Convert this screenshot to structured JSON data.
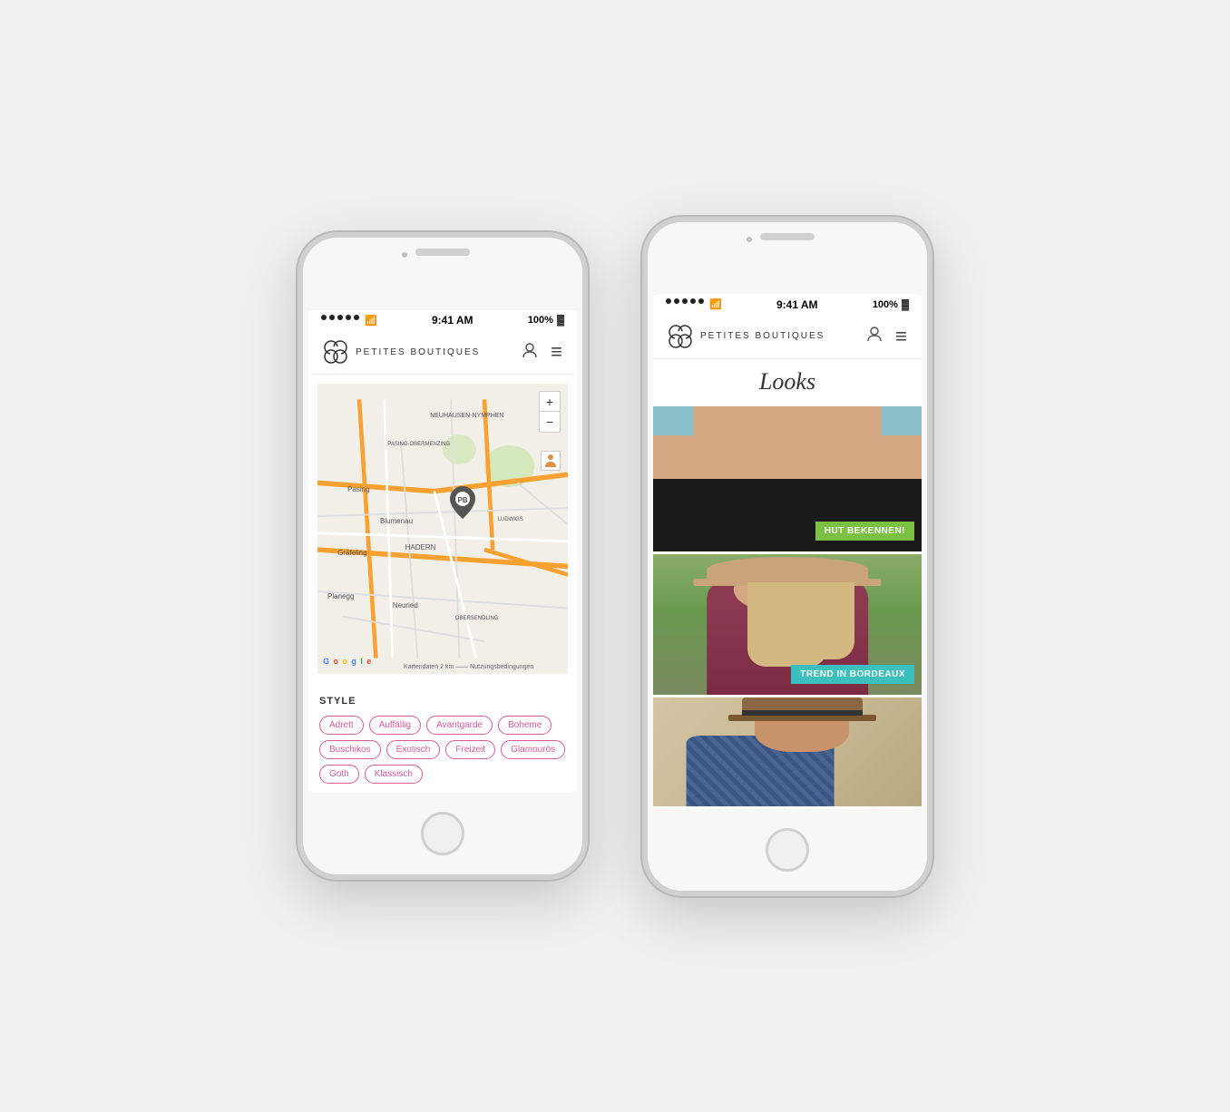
{
  "phones": {
    "left": {
      "status": {
        "dots": 5,
        "time": "9:41 AM",
        "battery": "100%"
      },
      "header": {
        "logo_text": "PETITES BOUTIQUES",
        "user_icon": "👤",
        "menu_icon": "≡"
      },
      "map": {
        "labels": [
          "Pasing",
          "Blumenau",
          "Gräfeling",
          "Planegg",
          "HADERN",
          "NEUHAUSEN-NYMPHEN",
          "PASING-OBERMENZING",
          "Neuried",
          "OBERSENDLING",
          "LUDWIGS",
          "Google"
        ],
        "controls": [
          "+",
          "–"
        ],
        "footer": "Kartendaten  2 km ——  Nutzungsbedingungen"
      },
      "style": {
        "title": "STYLE",
        "tags": [
          "Adrett",
          "Auffällig",
          "Avantgarde",
          "Boheme",
          "Buschikos",
          "Exotisch",
          "Freizeit",
          "Glamourös",
          "Goth",
          "Klassisch"
        ]
      }
    },
    "right": {
      "status": {
        "dots": 5,
        "time": "9:41 AM",
        "battery": "100%"
      },
      "header": {
        "logo_text": "PETITES BOUTIQUES",
        "user_icon": "👤",
        "menu_icon": "≡"
      },
      "looks": {
        "title": "Looks",
        "images": [
          {
            "badge": "HUT BEKENNEN!",
            "badge_color": "green"
          },
          {
            "badge": "TREND IN BORDEAUX",
            "badge_color": "teal"
          },
          {
            "badge": "",
            "badge_color": ""
          }
        ]
      }
    }
  }
}
